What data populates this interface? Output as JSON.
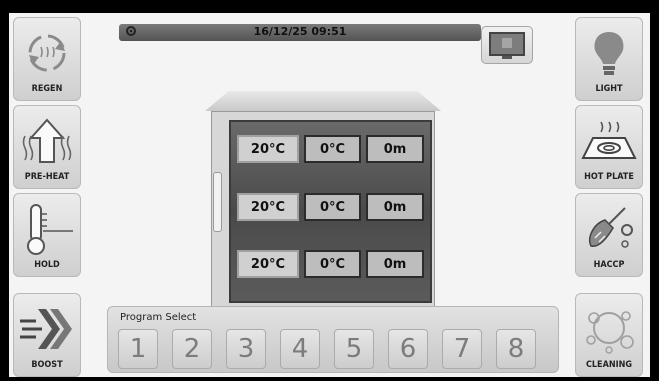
{
  "status_bar": {
    "datetime": "16/12/25 09:51"
  },
  "left_buttons": [
    {
      "label": "REGEN",
      "icon": "regen-cycle-icon"
    },
    {
      "label": "PRE-HEAT",
      "icon": "preheat-arrow-icon"
    },
    {
      "label": "HOLD",
      "icon": "thermometer-icon"
    },
    {
      "label": "BOOST",
      "icon": "boost-chevrons-icon"
    }
  ],
  "right_buttons": [
    {
      "label": "LIGHT",
      "icon": "light-bulb-icon"
    },
    {
      "label": "HOT PLATE",
      "icon": "hot-plate-icon"
    },
    {
      "label": "HACCP",
      "icon": "haccp-probe-icon"
    },
    {
      "label": "CLEANING",
      "icon": "cleaning-bubbles-icon"
    }
  ],
  "shelves": [
    {
      "temp": "20°C",
      "setpoint": "0°C",
      "time": "0m"
    },
    {
      "temp": "20°C",
      "setpoint": "0°C",
      "time": "0m"
    },
    {
      "temp": "20°C",
      "setpoint": "0°C",
      "time": "0m"
    }
  ],
  "program": {
    "label": "Program Select",
    "buttons": [
      "1",
      "2",
      "3",
      "4",
      "5",
      "6",
      "7",
      "8"
    ]
  },
  "colors": {
    "status_bar": "#5e5e5e",
    "oven_inner": "#555555",
    "button_bg": "#dcdcdc"
  }
}
